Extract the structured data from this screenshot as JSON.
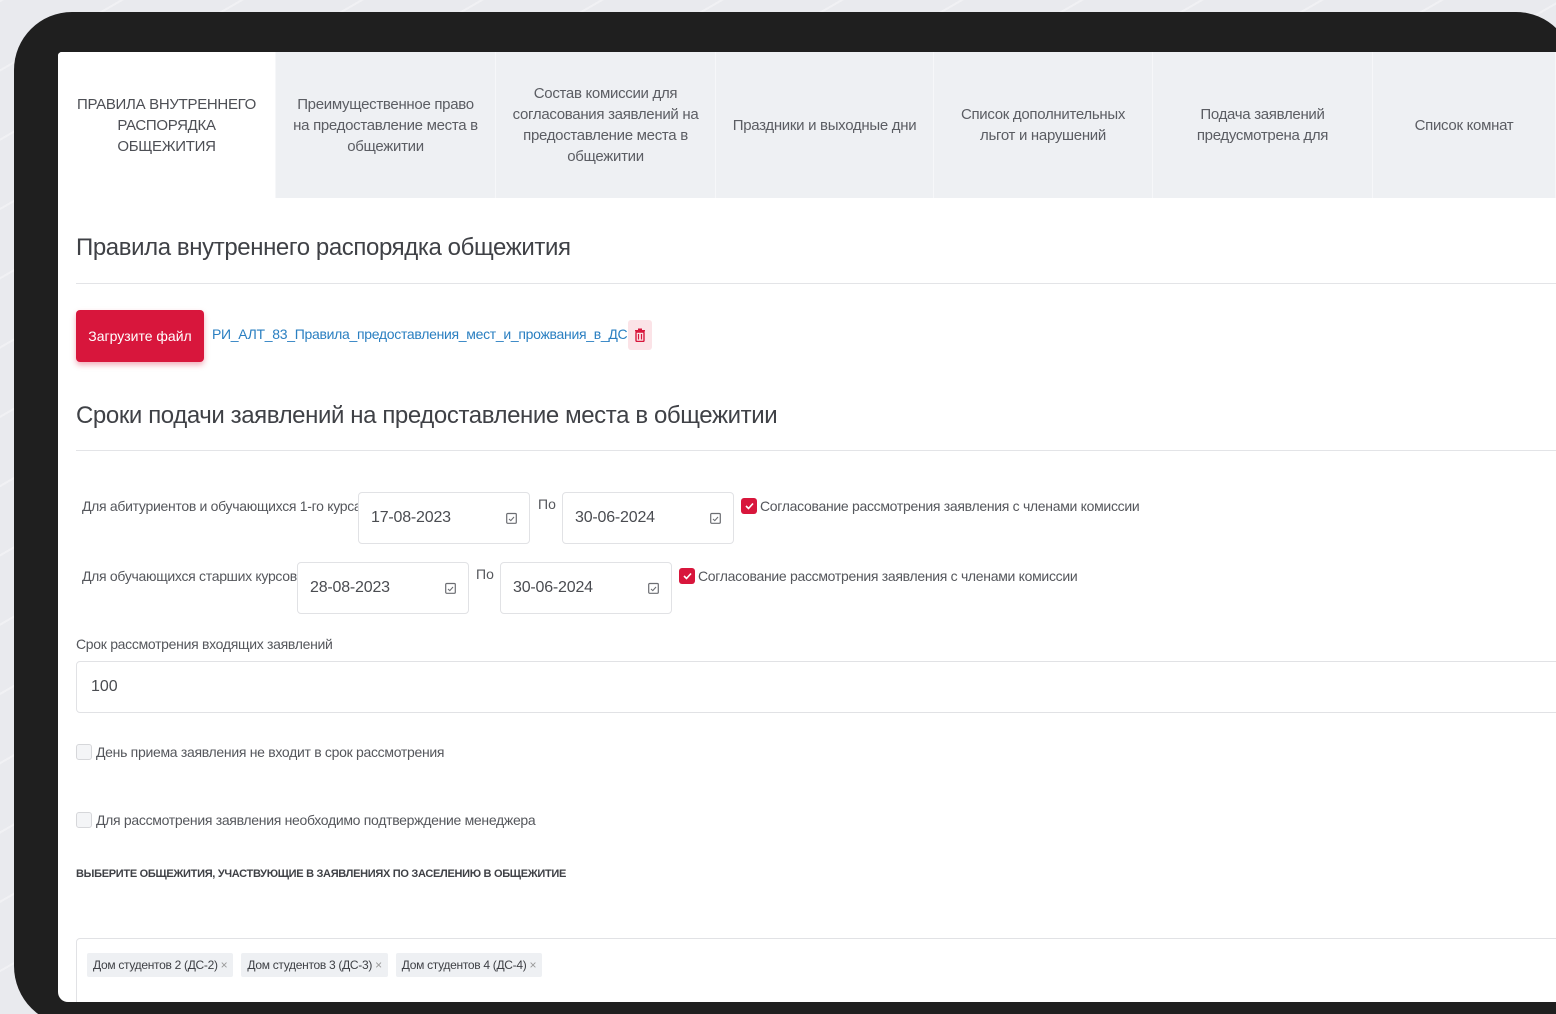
{
  "tabs": [
    {
      "label": "ПРАВИЛА ВНУТРЕННЕГО РАСПОРЯДКА ОБЩЕЖИТИЯ"
    },
    {
      "label": "Преимущественное право на предоставление места в общежитии"
    },
    {
      "label": "Состав комиссии для согласования заявлений на предоставление места в общежитии"
    },
    {
      "label": "Праздники и выходные дни"
    },
    {
      "label": "Список дополнительных льгот и нарушений"
    },
    {
      "label": "Подача заявлений предусмотрена для"
    },
    {
      "label": "Список комнат"
    }
  ],
  "rules": {
    "title": "Правила внутреннего распорядка общежития",
    "upload_label": "Загрузите файл",
    "file_name": "РИ_АЛТ_83_Правила_предоставления_мест_и_прожвания_в_ДС.pdf"
  },
  "deadlines": {
    "title": "Сроки подачи заявлений на предоставление места в общежитии",
    "rows": [
      {
        "label": "Для абитуриентов и обучающихся 1-го курса:",
        "from": "17-08-2023",
        "to_label": "По",
        "to": "30-06-2024",
        "approval_label": "Согласование рассмотрения заявления с членами комиссии",
        "approval_checked": true
      },
      {
        "label": "Для обучающихся старших курсов:",
        "from": "28-08-2023",
        "to_label": "По",
        "to": "30-06-2024",
        "approval_label": "Согласование рассмотрения заявления с членами комиссии",
        "approval_checked": true
      }
    ],
    "review_period_label": "Срок рассмотрения входящих заявлений",
    "review_period_value": "100",
    "checkbox_day_excluded": {
      "label": "День приема заявления не входит в срок рассмотрения",
      "checked": false
    },
    "checkbox_manager_confirm": {
      "label": "Для рассмотрения заявления необходимо подтверждение менеджера",
      "checked": false
    }
  },
  "dorms": {
    "label": "ВЫБЕРИТЕ ОБЩЕЖИТИЯ, УЧАСТВУЮЩИЕ В ЗАЯВЛЕНИЯХ ПО ЗАСЕЛЕНИЮ В ОБЩЕЖИТИЕ",
    "selected": [
      "Дом студентов 2 (ДС-2)",
      "Дом студентов 3 (ДС-3)",
      "Дом студентов 4 (ДС-4)"
    ],
    "remove_symbol": "×"
  },
  "colors": {
    "accent": "#d8163c",
    "link": "#2a7fc1"
  }
}
